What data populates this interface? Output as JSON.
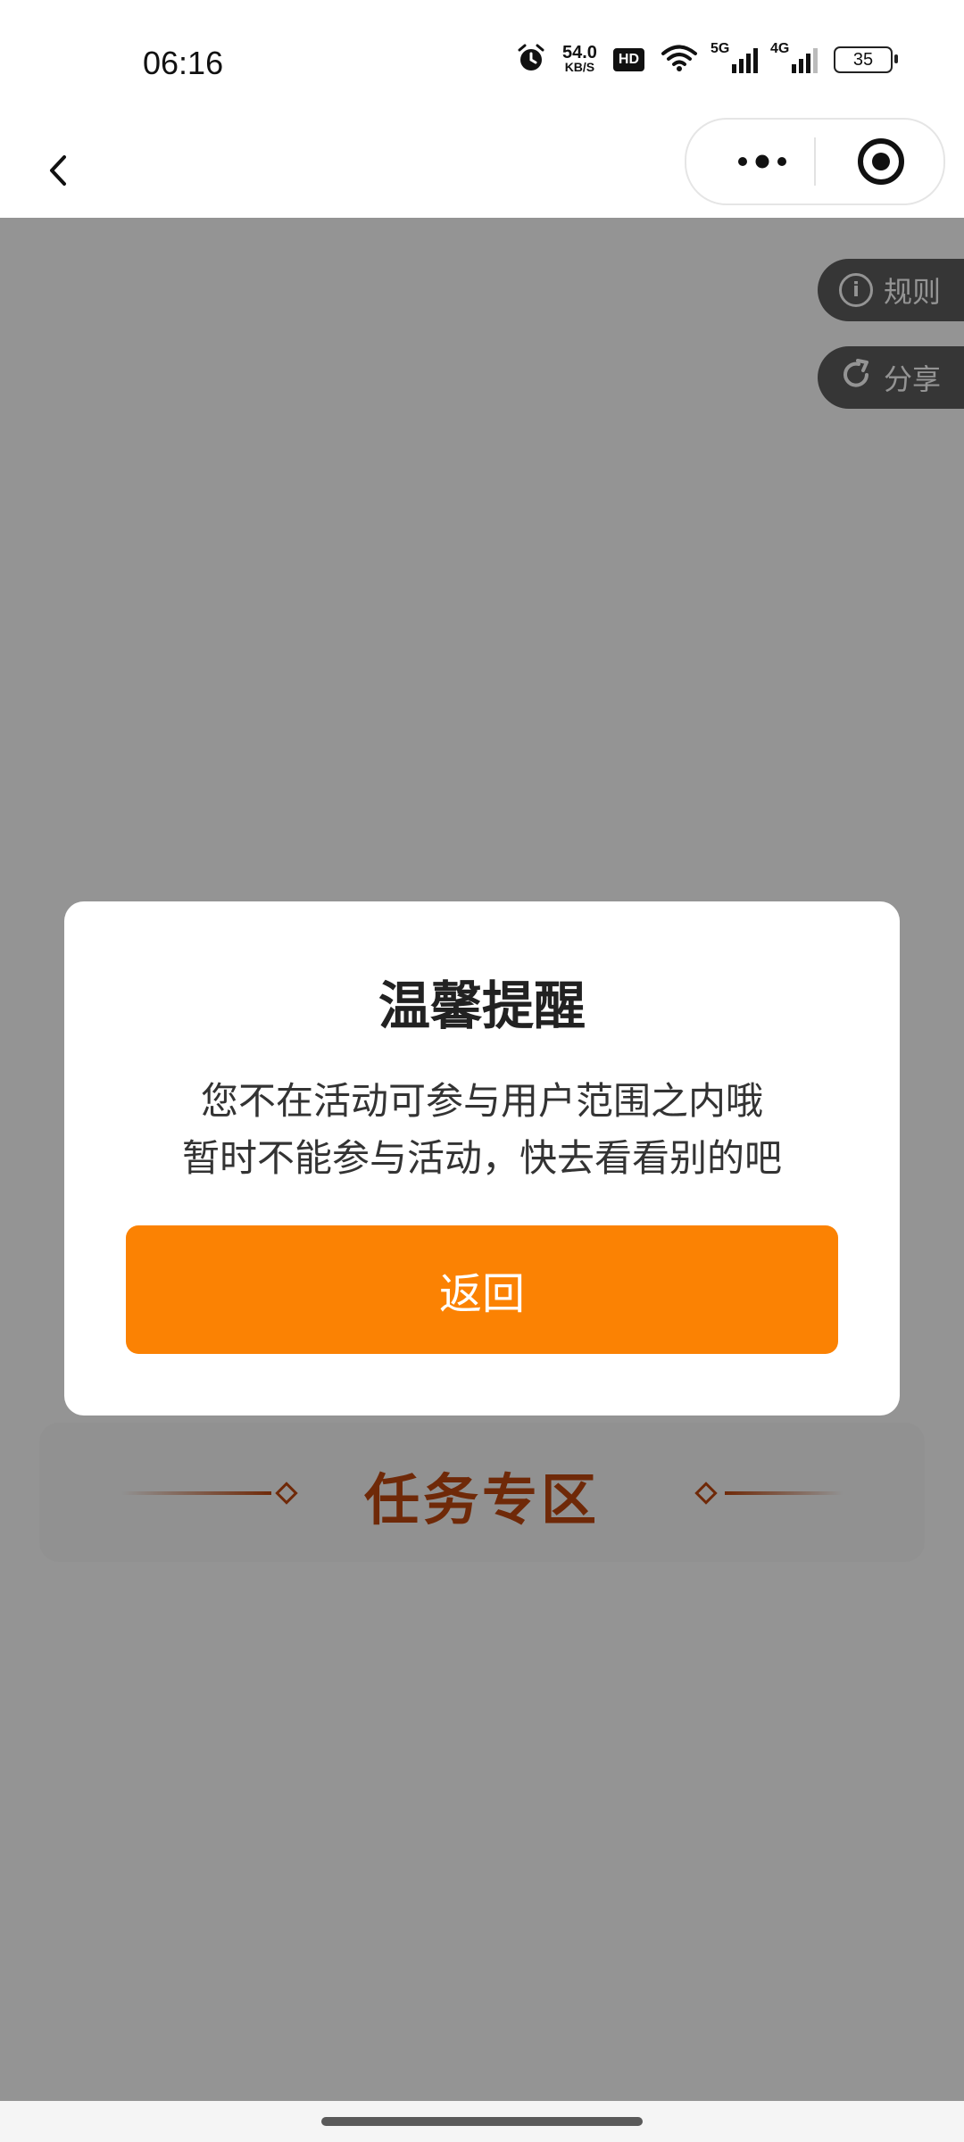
{
  "status_bar": {
    "time": "06:16",
    "net_speed_value": "54.0",
    "net_speed_unit": "KB/S",
    "hd_label": "HD",
    "signal_5g_label": "5G",
    "signal_4g_label": "4G",
    "battery_level": "35",
    "icons": [
      "alarm-icon",
      "wifi-icon",
      "signal-5g-icon",
      "signal-4g-icon",
      "battery-icon"
    ]
  },
  "nav": {
    "back_icon": "chevron-left-icon",
    "more_icon": "more-dots-icon",
    "close_icon": "target-circle-icon"
  },
  "floating": {
    "rules_label": "规则",
    "share_label": "分享"
  },
  "task_section": {
    "title": "任务专区"
  },
  "dialog": {
    "title": "温馨提醒",
    "message_line1": "您不在活动可参与用户范围之内哦",
    "message_line2": "暂时不能参与活动，快去看看别的吧",
    "button_label": "返回"
  },
  "colors": {
    "accent": "#fb8203",
    "task_title": "#c0480f",
    "overlay": "rgba(0,0,0,0.42)"
  }
}
